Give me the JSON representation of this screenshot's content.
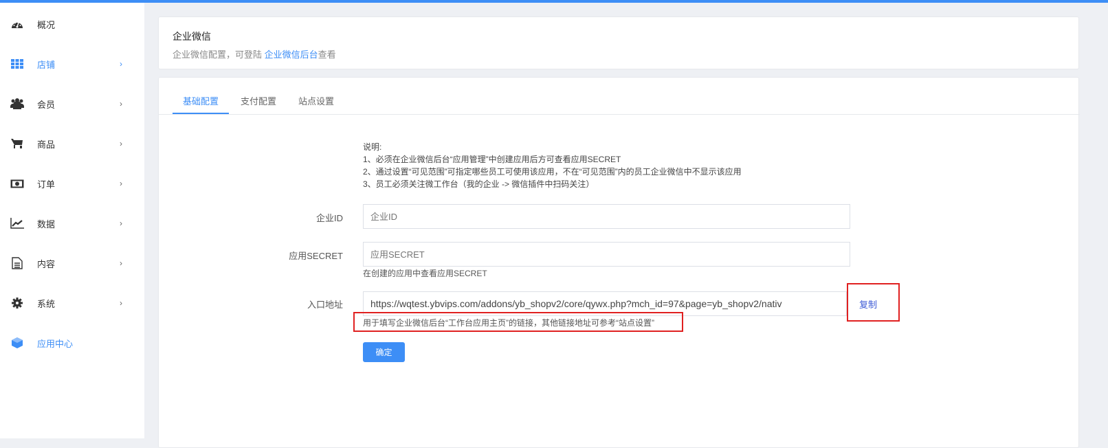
{
  "sidebar": {
    "items": [
      {
        "label": "概况",
        "icon": "dashboard-icon",
        "chevron": ""
      },
      {
        "label": "店铺",
        "icon": "grid-icon",
        "chevron": "›"
      },
      {
        "label": "会员",
        "icon": "users-icon",
        "chevron": "›"
      },
      {
        "label": "商品",
        "icon": "cart-icon",
        "chevron": "›"
      },
      {
        "label": "订单",
        "icon": "money-icon",
        "chevron": "›"
      },
      {
        "label": "数据",
        "icon": "chart-icon",
        "chevron": "›"
      },
      {
        "label": "内容",
        "icon": "document-icon",
        "chevron": "›"
      },
      {
        "label": "系统",
        "icon": "gear-icon",
        "chevron": "›"
      },
      {
        "label": "应用中心",
        "icon": "cube-icon",
        "chevron": ""
      }
    ]
  },
  "header": {
    "title": "企业微信",
    "subtitle": "企业微信配置，可登陆 ",
    "link": "企业微信后台",
    "suffix": "查看"
  },
  "tabs": [
    "基础配置",
    "支付配置",
    "站点设置"
  ],
  "notes": {
    "title": "说明:",
    "lines": [
      "1、必须在企业微信后台“应用管理”中创建应用后方可查看应用SECRET",
      "2、通过设置“可见范围”可指定哪些员工可使用该应用，不在“可见范围”内的员工企业微信中不显示该应用",
      "3、员工必须关注微工作台（我的企业 -> 微信插件中扫码关注）"
    ]
  },
  "form": {
    "corp_id": {
      "label": "企业ID",
      "placeholder": "企业ID"
    },
    "secret": {
      "label": "应用SECRET",
      "placeholder": "应用SECRET",
      "help": "在创建的应用中查看应用SECRET"
    },
    "entry": {
      "label": "入口地址",
      "value": "https://wqtest.ybvips.com/addons/yb_shopv2/core/qywx.php?mch_id=97&page=yb_shopv2/nativ",
      "help": "用于填写企业微信后台“工作台应用主页”的链接，其他链接地址可参考“站点设置”",
      "copy": "复制"
    },
    "submit": "确定"
  },
  "colors": {
    "accent": "#3d8ef6",
    "highlight": "#e02020"
  }
}
